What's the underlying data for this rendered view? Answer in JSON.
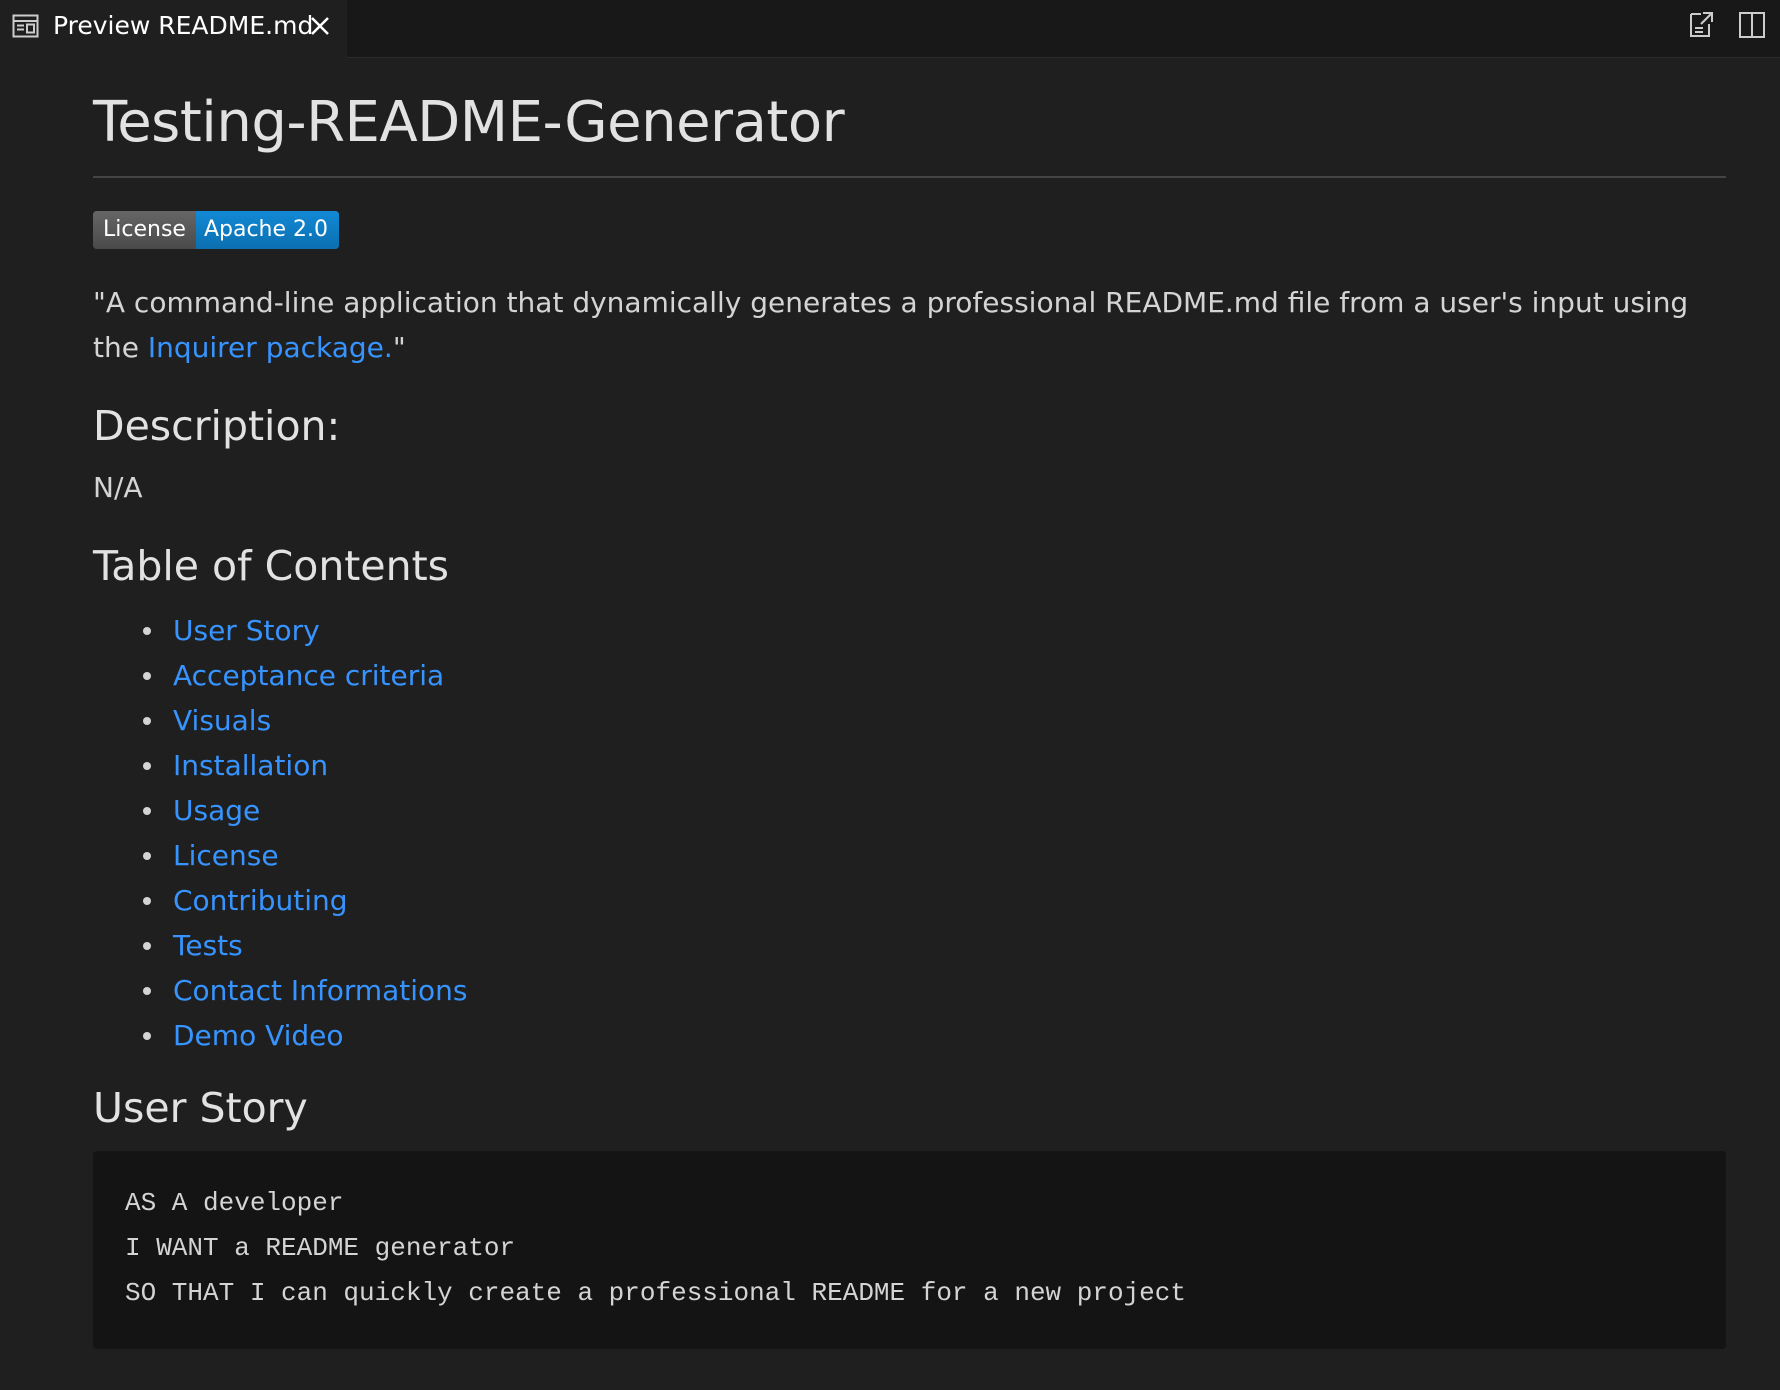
{
  "tab": {
    "title": "Preview README.md"
  },
  "toolbar": {
    "open_source_icon": "open-preview-source-icon",
    "split_editor_icon": "split-editor-icon"
  },
  "readme": {
    "title": "Testing-README-Generator",
    "badge": {
      "left": "License",
      "right": "Apache 2.0",
      "left_color": "#555555",
      "right_color": "#0d7cc4"
    },
    "tagline_before": "\"A command-line application that dynamically generates a professional README.md file from a user's input using the ",
    "tagline_link": "Inquirer package.",
    "tagline_after": "\"",
    "description_heading": "Description:",
    "description_text": "N/A",
    "toc_heading": "Table of Contents",
    "toc": [
      "User Story",
      "Acceptance criteria",
      "Visuals",
      "Installation",
      "Usage",
      "License",
      "Contributing",
      "Tests",
      "Contact Informations",
      "Demo Video"
    ],
    "user_story_heading": "User Story",
    "user_story_lines": [
      "AS A developer",
      "I WANT a README generator",
      "SO THAT I can quickly create a professional README for a new project"
    ]
  },
  "colors": {
    "background": "#1f1f1f",
    "link": "#3794ff",
    "code_background": "#141414"
  }
}
